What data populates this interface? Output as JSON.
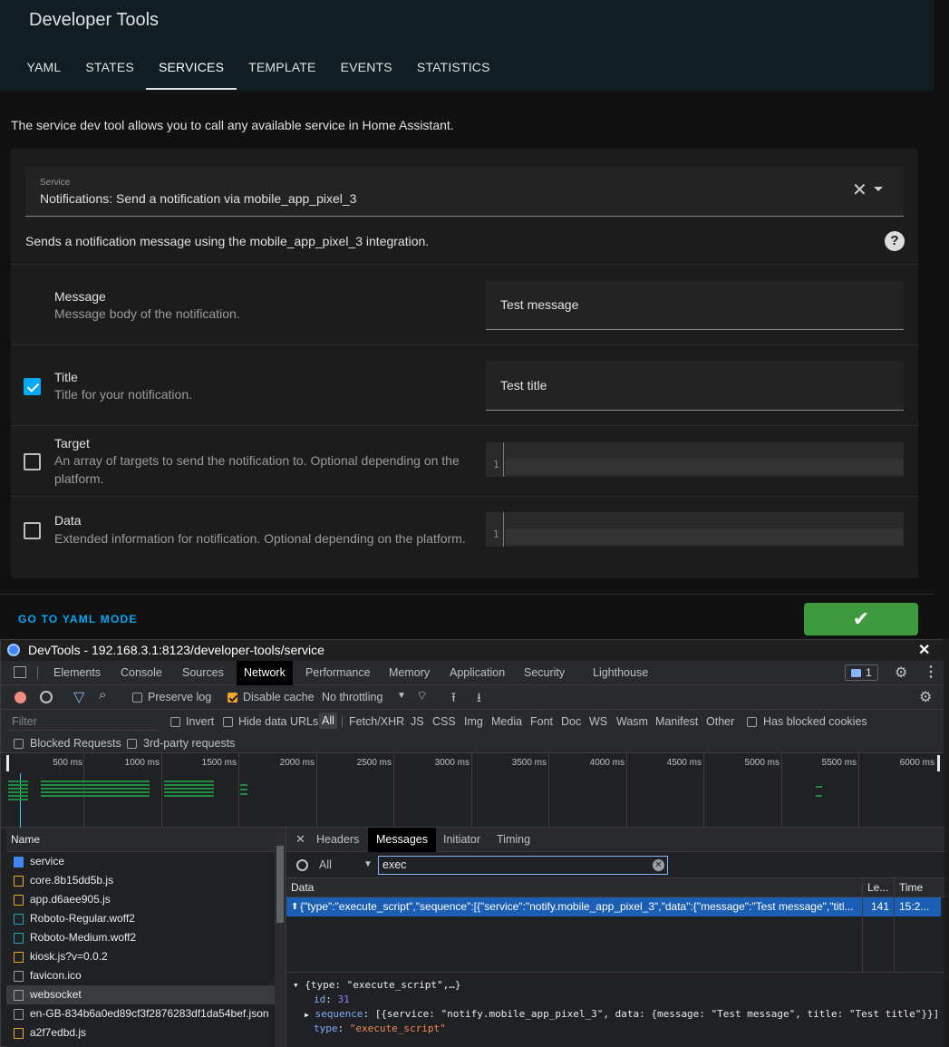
{
  "ha": {
    "title": "Developer Tools",
    "tabs": [
      "YAML",
      "STATES",
      "SERVICES",
      "TEMPLATE",
      "EVENTS",
      "STATISTICS"
    ],
    "active_tab": "SERVICES",
    "description": "The service dev tool allows you to call any available service in Home Assistant.",
    "service_label": "Service",
    "service_value": "Notifications: Send a notification via mobile_app_pixel_3",
    "service_summary": "Sends a notification message using the mobile_app_pixel_3 integration.",
    "fields": {
      "message": {
        "name": "Message",
        "description": "Message body of the notification.",
        "value": "Test message"
      },
      "title": {
        "name": "Title",
        "description": "Title for your notification.",
        "value": "Test title",
        "checked": true
      },
      "target": {
        "name": "Target",
        "description": "An array of targets to send the notification to. Optional depending on the platform.",
        "line": "1",
        "checked": false
      },
      "data": {
        "name": "Data",
        "description": "Extended information for notification. Optional depending on the platform.",
        "line": "1",
        "checked": false
      }
    },
    "yaml_mode_link": "GO TO YAML MODE",
    "call_button_icon": "check-icon",
    "colors": {
      "accent": "#03a9f4",
      "call_button": "#3d9a3f",
      "header": "#101e24"
    }
  },
  "devtools": {
    "window_title": "DevTools - 192.168.3.1:8123/developer-tools/service",
    "panels": [
      "Elements",
      "Console",
      "Sources",
      "Network",
      "Performance",
      "Memory",
      "Application",
      "Security",
      "Lighthouse"
    ],
    "active_panel": "Network",
    "issues_count": "1",
    "toolbar": {
      "preserve_log": "Preserve log",
      "disable_cache": "Disable cache",
      "throttling": "No throttling"
    },
    "filter": {
      "placeholder": "Filter",
      "invert": "Invert",
      "hide_data_urls": "Hide data URLs",
      "types": [
        "All",
        "Fetch/XHR",
        "JS",
        "CSS",
        "Img",
        "Media",
        "Font",
        "Doc",
        "WS",
        "Wasm",
        "Manifest",
        "Other"
      ],
      "has_blocked_cookies": "Has blocked cookies",
      "blocked_requests": "Blocked Requests",
      "third_party": "3rd-party requests"
    },
    "timeline_ticks": [
      "500 ms",
      "1000 ms",
      "1500 ms",
      "2000 ms",
      "2500 ms",
      "3000 ms",
      "3500 ms",
      "4000 ms",
      "4500 ms",
      "5000 ms",
      "5500 ms",
      "6000 ms"
    ],
    "name_header": "Name",
    "requests": [
      {
        "name": "service",
        "type": "doc"
      },
      {
        "name": "core.8b15dd5b.js",
        "type": "js"
      },
      {
        "name": "app.d6aee905.js",
        "type": "js"
      },
      {
        "name": "Roboto-Regular.woff2",
        "type": "font"
      },
      {
        "name": "Roboto-Medium.woff2",
        "type": "font"
      },
      {
        "name": "kiosk.js?v=0.0.2",
        "type": "js"
      },
      {
        "name": "favicon.ico",
        "type": "other"
      },
      {
        "name": "websocket",
        "type": "other"
      },
      {
        "name": "en-GB-834b6a0ed89cf3f2876283df1da54bef.json",
        "type": "other"
      },
      {
        "name": "a2f7edbd.js",
        "type": "js"
      }
    ],
    "selected_request": "websocket",
    "message_tabs": [
      "Headers",
      "Messages",
      "Initiator",
      "Timing"
    ],
    "active_message_tab": "Messages",
    "message_filter_type": "All",
    "message_search": "exec",
    "message_columns": {
      "data": "Data",
      "length": "Le...",
      "time": "Time"
    },
    "message_row": {
      "data": "{\"type\":\"execute_script\",\"sequence\":[{\"service\":\"notify.mobile_app_pixel_3\",\"data\":{\"message\":\"Test message\",\"titl...",
      "length": "141",
      "time": "15:2..."
    },
    "detail": {
      "summary": "{type: \"execute_script\",…}",
      "id_key": "id",
      "id_value": "31",
      "sequence_key": "sequence",
      "sequence_value": "[{service: \"notify.mobile_app_pixel_3\", data: {message: \"Test message\", title: \"Test title\"}}]",
      "type_key": "type",
      "type_value": "\"execute_script\""
    }
  }
}
